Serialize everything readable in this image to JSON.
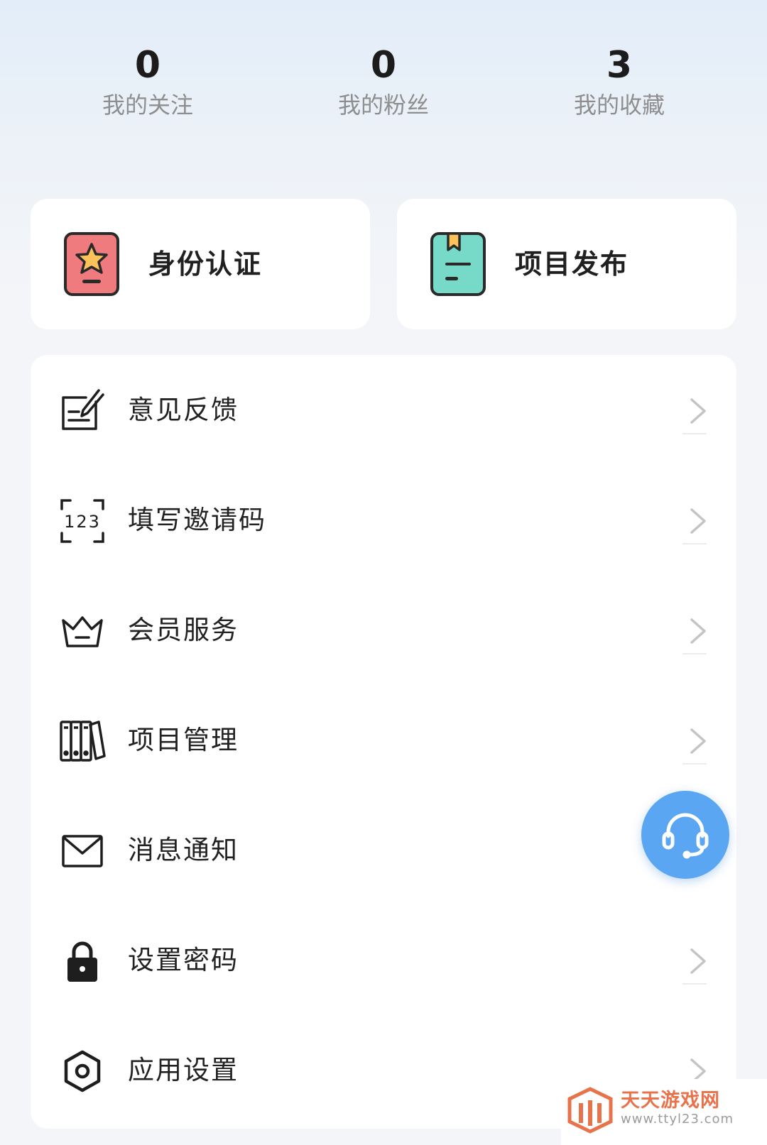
{
  "stats": [
    {
      "value": "0",
      "label": "我的关注"
    },
    {
      "value": "0",
      "label": "我的粉丝"
    },
    {
      "value": "3",
      "label": "我的收藏"
    }
  ],
  "cards": [
    {
      "label": "身份认证",
      "icon": "id-badge-star-icon"
    },
    {
      "label": "项目发布",
      "icon": "bookmark-document-icon"
    }
  ],
  "menu": [
    {
      "label": "意见反馈",
      "icon": "edit-note-icon"
    },
    {
      "label": "填写邀请码",
      "icon": "invite-code-123-icon"
    },
    {
      "label": "会员服务",
      "icon": "crown-icon"
    },
    {
      "label": "项目管理",
      "icon": "binders-icon"
    },
    {
      "label": "消息通知",
      "icon": "envelope-icon"
    },
    {
      "label": "设置密码",
      "icon": "lock-icon"
    },
    {
      "label": "应用设置",
      "icon": "hexagon-settings-icon"
    }
  ],
  "support": {
    "icon": "headset-icon"
  },
  "watermark": {
    "text": "天天游戏网",
    "url": "www.ttyl23.com"
  },
  "colors": {
    "support": "#5aa6f2",
    "card_red": "#f07b7f",
    "card_teal": "#77dac9",
    "star": "#fbc35a"
  }
}
